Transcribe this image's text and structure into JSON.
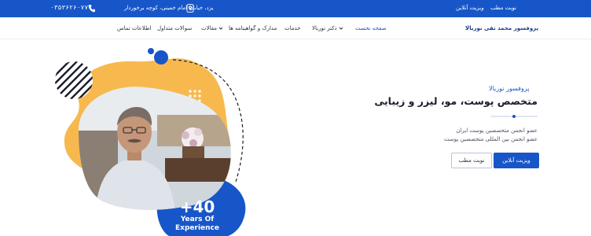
{
  "topbar": {
    "phone": "۰۳۵۳۶۲۶۰۷۷۷",
    "phone_icon": "phone-icon",
    "address": "یزد، خیابان امام خمینی، کوچه برخوردار",
    "address_icon": "map-pin-icon",
    "link_online": "ویزیت آنلاین",
    "link_office": "نوبت مطب"
  },
  "nav": {
    "brand": "پروفسور محمد تقی نوربالا",
    "items": [
      {
        "label": "صفحه نخست",
        "active": true
      },
      {
        "label": "دکتر نوربالا",
        "dropdown": true
      },
      {
        "label": "خدمات"
      },
      {
        "label": "مدارک و گواهینامه ها"
      },
      {
        "label": "مقالات",
        "dropdown": true
      },
      {
        "label": "سوالات متداول"
      },
      {
        "label": "اطلاعات تماس"
      }
    ]
  },
  "hero": {
    "subtitle": "پروفسور نوربالا",
    "title": "متخصص پوست، مو، لیزر و زیبایی",
    "member_1": "عضو انجمن متخصصین پوست ایران",
    "member_2": "عضو انجمن بین المللی متخصصین پوست",
    "btn_online": "ویزیت آنلاین",
    "btn_office": "نوبت مطب",
    "badge_number": "+40",
    "badge_line1": "Years Of",
    "badge_line2": "Experience"
  },
  "colors": {
    "primary": "#1756c9",
    "accent_orange": "#f7b94e",
    "dark": "#1b1d2a"
  }
}
